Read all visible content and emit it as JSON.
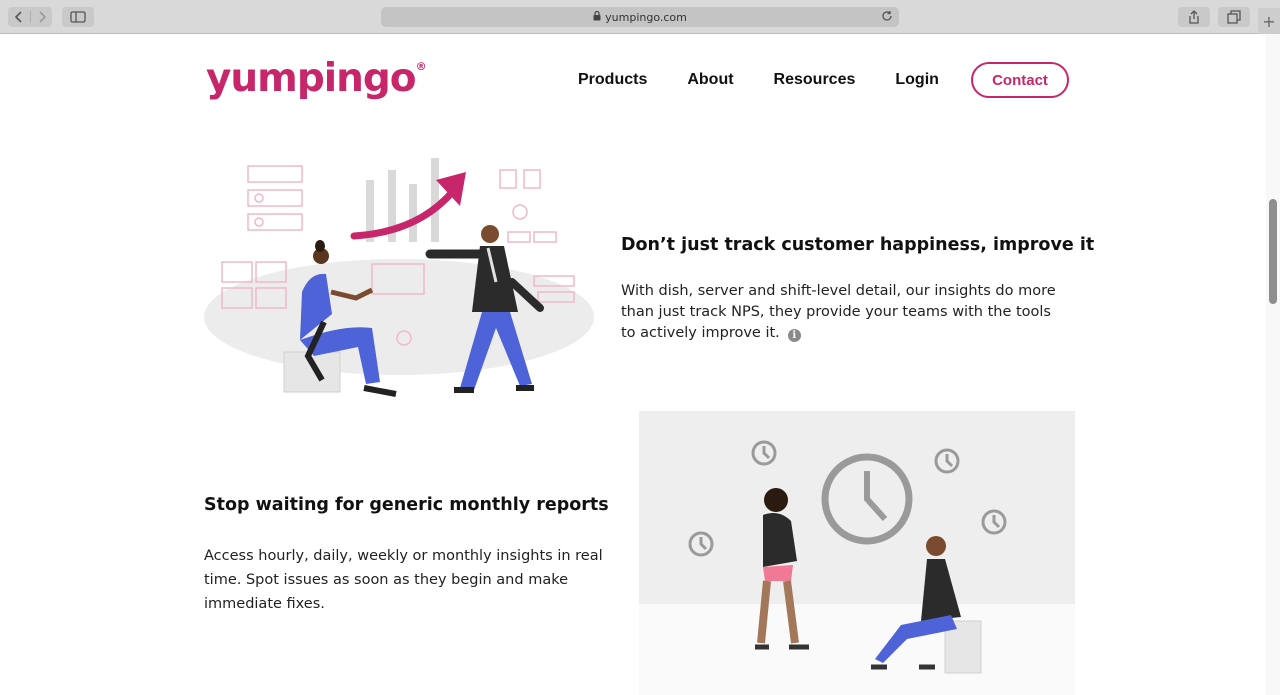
{
  "browser": {
    "url": "yumpingo.com",
    "plus_label": "+"
  },
  "header": {
    "logo_text": "yumpingo",
    "logo_mark": "®",
    "nav": [
      {
        "label": "Products"
      },
      {
        "label": "About"
      },
      {
        "label": "Resources"
      },
      {
        "label": "Login"
      }
    ],
    "contact_label": "Contact"
  },
  "section1": {
    "title": "Don’t just track customer happiness, improve it",
    "body_lines": [
      "With dish, server and shift-level detail, our insights do more",
      "than just track NPS, they provide your teams with the tools",
      "to actively improve it."
    ],
    "info_glyph": "i"
  },
  "section2": {
    "title": "Stop waiting for generic monthly reports",
    "body_lines": [
      "Access hourly, daily, weekly or monthly insights in real",
      "time. Spot issues as soon as they begin and make",
      "immediate fixes."
    ]
  },
  "colors": {
    "brand": "#c8266b",
    "figure_blue": "#4f63d8",
    "skin_dark": "#7a4b2e",
    "pants_pink": "#f07a95"
  },
  "icons": [
    "back-icon",
    "forward-icon",
    "sidebar-icon",
    "lock-icon",
    "reload-icon",
    "share-icon",
    "tabs-icon",
    "info-icon"
  ]
}
